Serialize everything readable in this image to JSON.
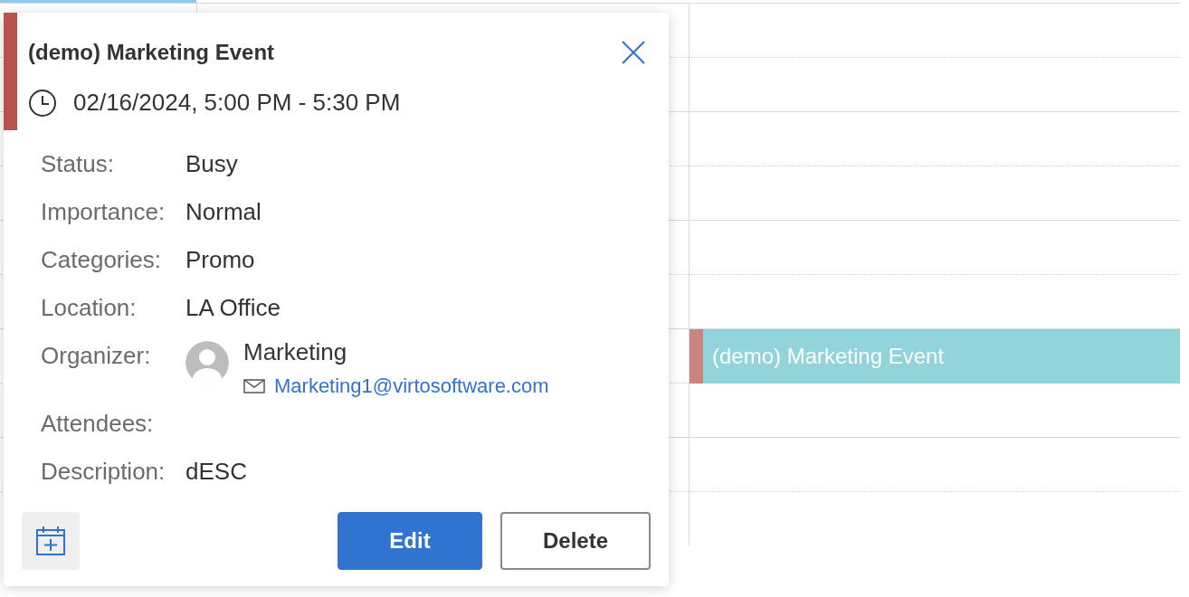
{
  "calendar": {
    "events": [
      {
        "title": "(demo) Marketing Event",
        "color": "#c98580"
      }
    ]
  },
  "popup": {
    "title": "(demo) Marketing Event",
    "color": "#b85450",
    "datetime": "02/16/2024, 5:00 PM - 5:30 PM",
    "fields": [
      {
        "kind": "text",
        "label": "Status:",
        "value": "Busy"
      },
      {
        "kind": "text",
        "label": "Importance:",
        "value": "Normal"
      },
      {
        "kind": "text",
        "label": "Categories:",
        "value": "Promo"
      },
      {
        "kind": "text",
        "label": "Location:",
        "value": "LA Office"
      },
      {
        "kind": "person",
        "label": "Organizer:",
        "name": "Marketing",
        "email": "Marketing1@virtosoftware.com"
      },
      {
        "kind": "text",
        "label": "Attendees:"
      },
      {
        "kind": "text",
        "label": "Description:",
        "value": "dESC"
      }
    ],
    "buttons": [
      {
        "kind": "primary",
        "label": "Edit"
      },
      {
        "kind": "secondary",
        "label": "Delete"
      }
    ]
  }
}
